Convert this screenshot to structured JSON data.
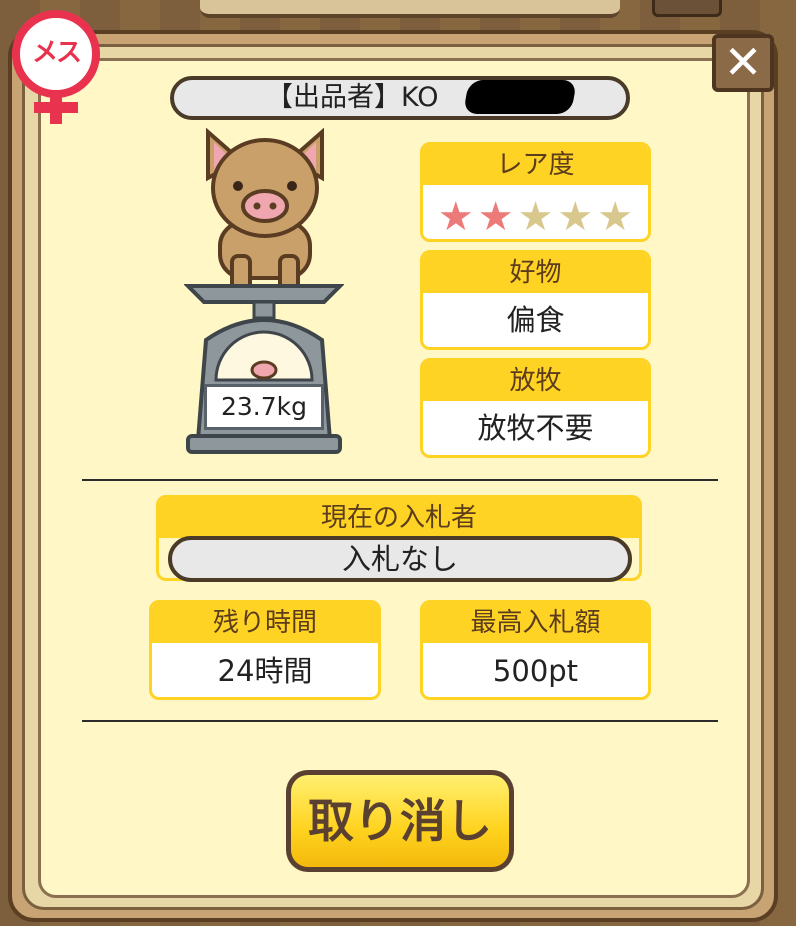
{
  "seller": {
    "label": "【出品者】KO"
  },
  "pig": {
    "weight": "23.7kg"
  },
  "badge": {
    "label": "メス"
  },
  "close": {
    "label": "✕"
  },
  "rarity": {
    "label": "レア度",
    "filled_stars": 2,
    "total_stars": 5
  },
  "favorite": {
    "label": "好物",
    "value": "偏食"
  },
  "grazing": {
    "label": "放牧",
    "value": "放牧不要"
  },
  "current_bidder": {
    "label": "現在の入札者",
    "value": "入札なし"
  },
  "time_left": {
    "label": "残り時間",
    "value": "24時間"
  },
  "highest_bid": {
    "label": "最高入札額",
    "value": "500pt"
  },
  "cancel": {
    "label": "取り消し"
  },
  "colors": {
    "accent": "#ffd324",
    "star_filled": "#ec7a78",
    "star_empty": "#d9c88e",
    "panel": "#fff8c6"
  }
}
